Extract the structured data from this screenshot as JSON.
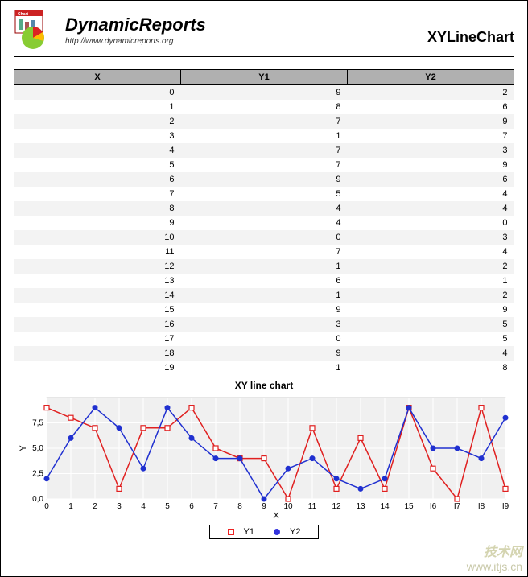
{
  "header": {
    "brand": "DynamicReports",
    "url": "http://www.dynamicreports.org",
    "page_title": "XYLineChart"
  },
  "table": {
    "columns": [
      "X",
      "Y1",
      "Y2"
    ],
    "rows": [
      {
        "x": 0,
        "y1": 9,
        "y2": 2
      },
      {
        "x": 1,
        "y1": 8,
        "y2": 6
      },
      {
        "x": 2,
        "y1": 7,
        "y2": 9
      },
      {
        "x": 3,
        "y1": 1,
        "y2": 7
      },
      {
        "x": 4,
        "y1": 7,
        "y2": 3
      },
      {
        "x": 5,
        "y1": 7,
        "y2": 9
      },
      {
        "x": 6,
        "y1": 9,
        "y2": 6
      },
      {
        "x": 7,
        "y1": 5,
        "y2": 4
      },
      {
        "x": 8,
        "y1": 4,
        "y2": 4
      },
      {
        "x": 9,
        "y1": 4,
        "y2": 0
      },
      {
        "x": 10,
        "y1": 0,
        "y2": 3
      },
      {
        "x": 11,
        "y1": 7,
        "y2": 4
      },
      {
        "x": 12,
        "y1": 1,
        "y2": 2
      },
      {
        "x": 13,
        "y1": 6,
        "y2": 1
      },
      {
        "x": 14,
        "y1": 1,
        "y2": 2
      },
      {
        "x": 15,
        "y1": 9,
        "y2": 9
      },
      {
        "x": 16,
        "y1": 3,
        "y2": 5
      },
      {
        "x": 17,
        "y1": 0,
        "y2": 5
      },
      {
        "x": 18,
        "y1": 9,
        "y2": 4
      },
      {
        "x": 19,
        "y1": 1,
        "y2": 8
      }
    ]
  },
  "chart_data": {
    "type": "line",
    "title": "XY line chart",
    "xlabel": "X",
    "ylabel": "Y",
    "x": [
      0,
      1,
      2,
      3,
      4,
      5,
      6,
      7,
      8,
      9,
      10,
      11,
      12,
      13,
      14,
      15,
      16,
      17,
      18,
      19
    ],
    "series": [
      {
        "name": "Y1",
        "values": [
          9,
          8,
          7,
          1,
          7,
          7,
          9,
          5,
          4,
          4,
          0,
          7,
          1,
          6,
          1,
          9,
          3,
          0,
          9,
          1
        ],
        "color": "#e02020"
      },
      {
        "name": "Y2",
        "values": [
          2,
          6,
          9,
          7,
          3,
          9,
          6,
          4,
          4,
          0,
          3,
          4,
          2,
          1,
          2,
          9,
          5,
          5,
          4,
          8
        ],
        "color": "#2030d0"
      }
    ],
    "xlim": [
      0,
      19
    ],
    "ylim": [
      0,
      10
    ],
    "yticks": [
      0.0,
      2.5,
      5.0,
      7.5
    ],
    "ytick_labels": [
      "0,0",
      "2,5",
      "5,0",
      "7,5"
    ],
    "legend_position": "bottom"
  },
  "legend": {
    "y1": "Y1",
    "y2": "Y2"
  },
  "watermark": {
    "line1": "技术网",
    "line2": "www.itjs.cn"
  }
}
